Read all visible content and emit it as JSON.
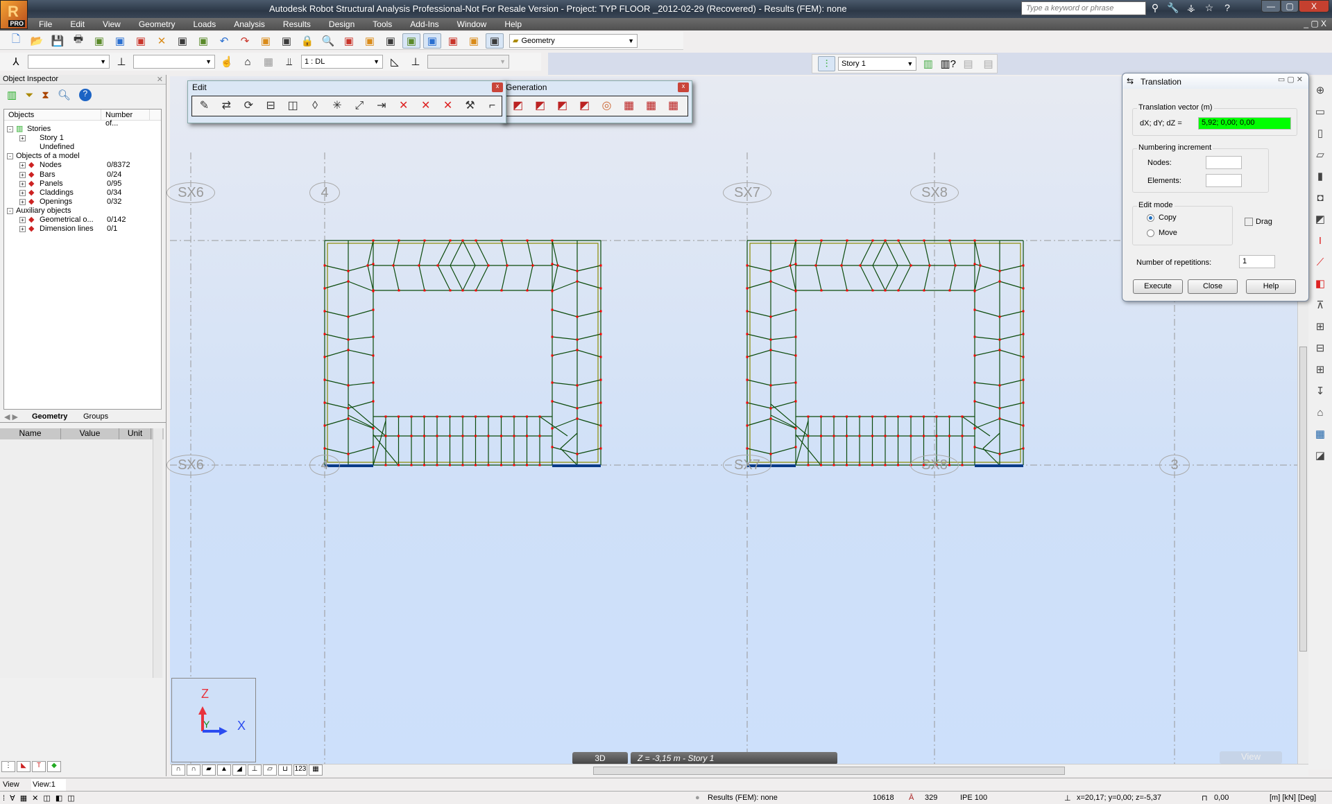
{
  "window": {
    "title": "Autodesk Robot Structural Analysis Professional-Not For Resale Version - Project: TYP FLOOR _2012-02-29 (Recovered) - Results (FEM): none",
    "logo_text": "R",
    "logo_badge": "PRO",
    "search_placeholder": "Type a keyword or phrase",
    "title_icons": [
      "binoculars-icon",
      "key-icon",
      "satellite-icon",
      "star-icon",
      "help-icon"
    ],
    "controls": [
      "minimize",
      "restore",
      "close"
    ]
  },
  "menu": [
    "File",
    "Edit",
    "View",
    "Geometry",
    "Loads",
    "Analysis",
    "Results",
    "Design",
    "Tools",
    "Add-Ins",
    "Window",
    "Help"
  ],
  "toolbar1": {
    "icons": [
      "new-icon",
      "open-icon",
      "save-icon",
      "print-icon",
      "print-preview-book-icon",
      "preview-icon",
      "screen-capture-icon",
      "delete-icon",
      "copy-icon",
      "paste-icon",
      "undo-icon",
      "redo-icon",
      "calculator-icon",
      "calc-options-icon",
      "lock-icon",
      "zoom-icon",
      "pan-icon",
      "display-icon",
      "supports-icon",
      "structure-model-icon",
      "section-icon",
      "structure-type-icon",
      "preferences-icon",
      "layout-icon"
    ],
    "layout_selector": "Geometry"
  },
  "toolbar2": {
    "combo1": "",
    "combo2": "",
    "load_case": "1 : DL",
    "combo4": ""
  },
  "story_bar": {
    "story": "Story 1"
  },
  "object_inspector": {
    "title": "Object Inspector",
    "columns": [
      "Objects",
      "Number of..."
    ],
    "tree": [
      {
        "label": "Stories",
        "count": "",
        "level": 0,
        "expander": "-"
      },
      {
        "label": "Story 1",
        "count": "",
        "level": 1,
        "expander": "+"
      },
      {
        "label": "Undefined",
        "count": "",
        "level": 1,
        "expander": ""
      },
      {
        "label": "Objects of a model",
        "count": "",
        "level": 0,
        "expander": "-"
      },
      {
        "label": "Nodes",
        "count": "0/8372",
        "level": 1,
        "expander": "+"
      },
      {
        "label": "Bars",
        "count": "0/24",
        "level": 1,
        "expander": "+"
      },
      {
        "label": "Panels",
        "count": "0/95",
        "level": 1,
        "expander": "+"
      },
      {
        "label": "Claddings",
        "count": "0/34",
        "level": 1,
        "expander": "+"
      },
      {
        "label": "Openings",
        "count": "0/32",
        "level": 1,
        "expander": "+"
      },
      {
        "label": "Auxiliary objects",
        "count": "",
        "level": 0,
        "expander": "-"
      },
      {
        "label": "Geometrical o...",
        "count": "0/142",
        "level": 1,
        "expander": "+"
      },
      {
        "label": "Dimension lines",
        "count": "0/1",
        "level": 1,
        "expander": "+"
      }
    ],
    "tabs": [
      "Geometry",
      "Groups"
    ],
    "active_tab": "Geometry",
    "props_columns": [
      "Name",
      "Value",
      "Unit"
    ]
  },
  "edit_toolbar": {
    "title": "Edit",
    "close": "x",
    "icons": [
      "modify-icon",
      "translate-icon",
      "rotate-icon",
      "mirror-horizontal-icon",
      "mirror-vertical-icon",
      "mirror-plane-icon",
      "offset-icon",
      "scale-icon",
      "extend-icon",
      "trim-icon",
      "divide-icon",
      "intersect-icon",
      "cut-icon",
      "corner-icon"
    ]
  },
  "generation_toolbar": {
    "title": "Generation",
    "close": "x",
    "icons": [
      "mesh-lock-icon",
      "mesh-unlock-icon",
      "mesh-generate-icon",
      "mesh-delete-icon",
      "target-icon",
      "panel-split-1-icon",
      "panel-split-2-icon",
      "panel-split-3-icon"
    ]
  },
  "translation_dialog": {
    "title": "Translation",
    "vector_group": "Translation vector (m)",
    "vector_label": "dX; dY; dZ  =",
    "vector_value": "5,92; 0,00; 0,00",
    "vector_bg": "#00ff00",
    "numbering_group": "Numbering increment",
    "nodes_label": "Nodes:",
    "nodes_value": "",
    "elements_label": "Elements:",
    "elements_value": "",
    "edit_mode_group": "Edit mode",
    "copy_label": "Copy",
    "move_label": "Move",
    "selected_mode": "Copy",
    "drag_label": "Drag",
    "drag_checked": false,
    "repetitions_label": "Number of repetitions:",
    "repetitions_value": "1",
    "execute": "Execute",
    "close": "Close",
    "help": "Help"
  },
  "grid_labels": {
    "top": [
      "SX6",
      "4",
      "SX7",
      "SX8"
    ],
    "bottom": [
      "SX6",
      "4",
      "SX7",
      "SX8",
      "3"
    ]
  },
  "colors": {
    "mesh": "#0b4a0b",
    "node": "#ff0000",
    "contour": "#8a8a00",
    "support": "#0a3c88",
    "axis": "#999999"
  },
  "right_toolbar": [
    "axis-grid-icon",
    "beam-icon",
    "column-icon",
    "slab-icon",
    "wall-icon",
    "opening-wall-icon",
    "section-shape-icon",
    "ibeam-icon",
    "thickness-icon",
    "material-icon",
    "release-icon",
    "offset-bar-icon",
    "bracing-icon",
    "truss-icon",
    "load-icon",
    "cladding-icon",
    "table-icon",
    "story-icon"
  ],
  "axes_gizmo": {
    "z": "Z",
    "y": "Y",
    "x": "X"
  },
  "view": {
    "mode": "3D",
    "level": "Z = -3,15 m - Story 1",
    "view_button": "View"
  },
  "view_bar": {
    "label": "View",
    "value": "View:1"
  },
  "status": {
    "results": "Results (FEM): none",
    "count": "10618",
    "section_num": "329",
    "section": "IPE 100",
    "coords": "x=20,17; y=0,00; z=-5,37",
    "angle": "0,00",
    "units": "[m] [kN] [Deg]"
  }
}
